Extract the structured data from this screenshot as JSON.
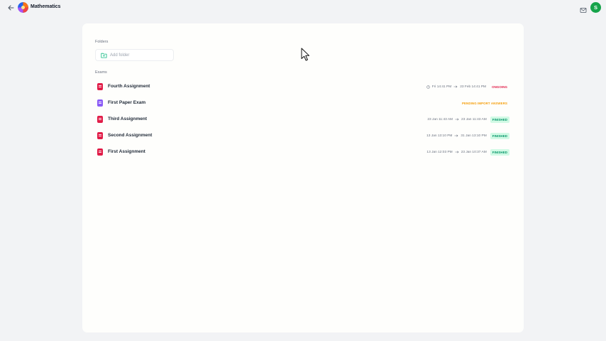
{
  "header": {
    "back_icon": "arrow-left-icon",
    "logo_icon": "subject-logo-icon",
    "title": "Mathematics",
    "mail_icon": "mail-icon",
    "avatar_initial": "S",
    "avatar_color": "#16a34a"
  },
  "folders": {
    "section_label": "Folders",
    "add_folder_label": "Add folder",
    "add_folder_icon": "folder-plus-icon"
  },
  "exams": {
    "section_label": "Exams",
    "items": [
      {
        "name": "Fourth Assignment",
        "icon": "assignment-icon",
        "icon_color": "#e11d48",
        "start": "Fri 14:41 PM",
        "end": "23 Feb 14:41 PM",
        "clock_icon": true,
        "status": "ONGOING",
        "status_color": "#e11d48"
      },
      {
        "name": "First Paper Exam",
        "icon": "paper-exam-icon",
        "icon_color": "#8b5cf6",
        "start": "",
        "end": "",
        "clock_icon": false,
        "status": "PENDING IMPORT ANSWERS",
        "status_color": "#f59e0b"
      },
      {
        "name": "Third Assignment",
        "icon": "assignment-icon",
        "icon_color": "#e11d48",
        "start": "23 Jan 11:43 AM",
        "end": "23 Jan 11:43 AM",
        "clock_icon": false,
        "status": "FINISHED",
        "status_color": "#059669"
      },
      {
        "name": "Second Assignment",
        "icon": "assignment-icon",
        "icon_color": "#e11d48",
        "start": "13 Jan 13:10 PM",
        "end": "31 Jan 13:10 PM",
        "clock_icon": false,
        "status": "FINISHED",
        "status_color": "#059669"
      },
      {
        "name": "First Assignment",
        "icon": "assignment-icon",
        "icon_color": "#e11d48",
        "start": "13 Jan 12:03 PM",
        "end": "23 Jan 10:37 AM",
        "clock_icon": false,
        "status": "FINISHED",
        "status_color": "#059669"
      }
    ]
  }
}
